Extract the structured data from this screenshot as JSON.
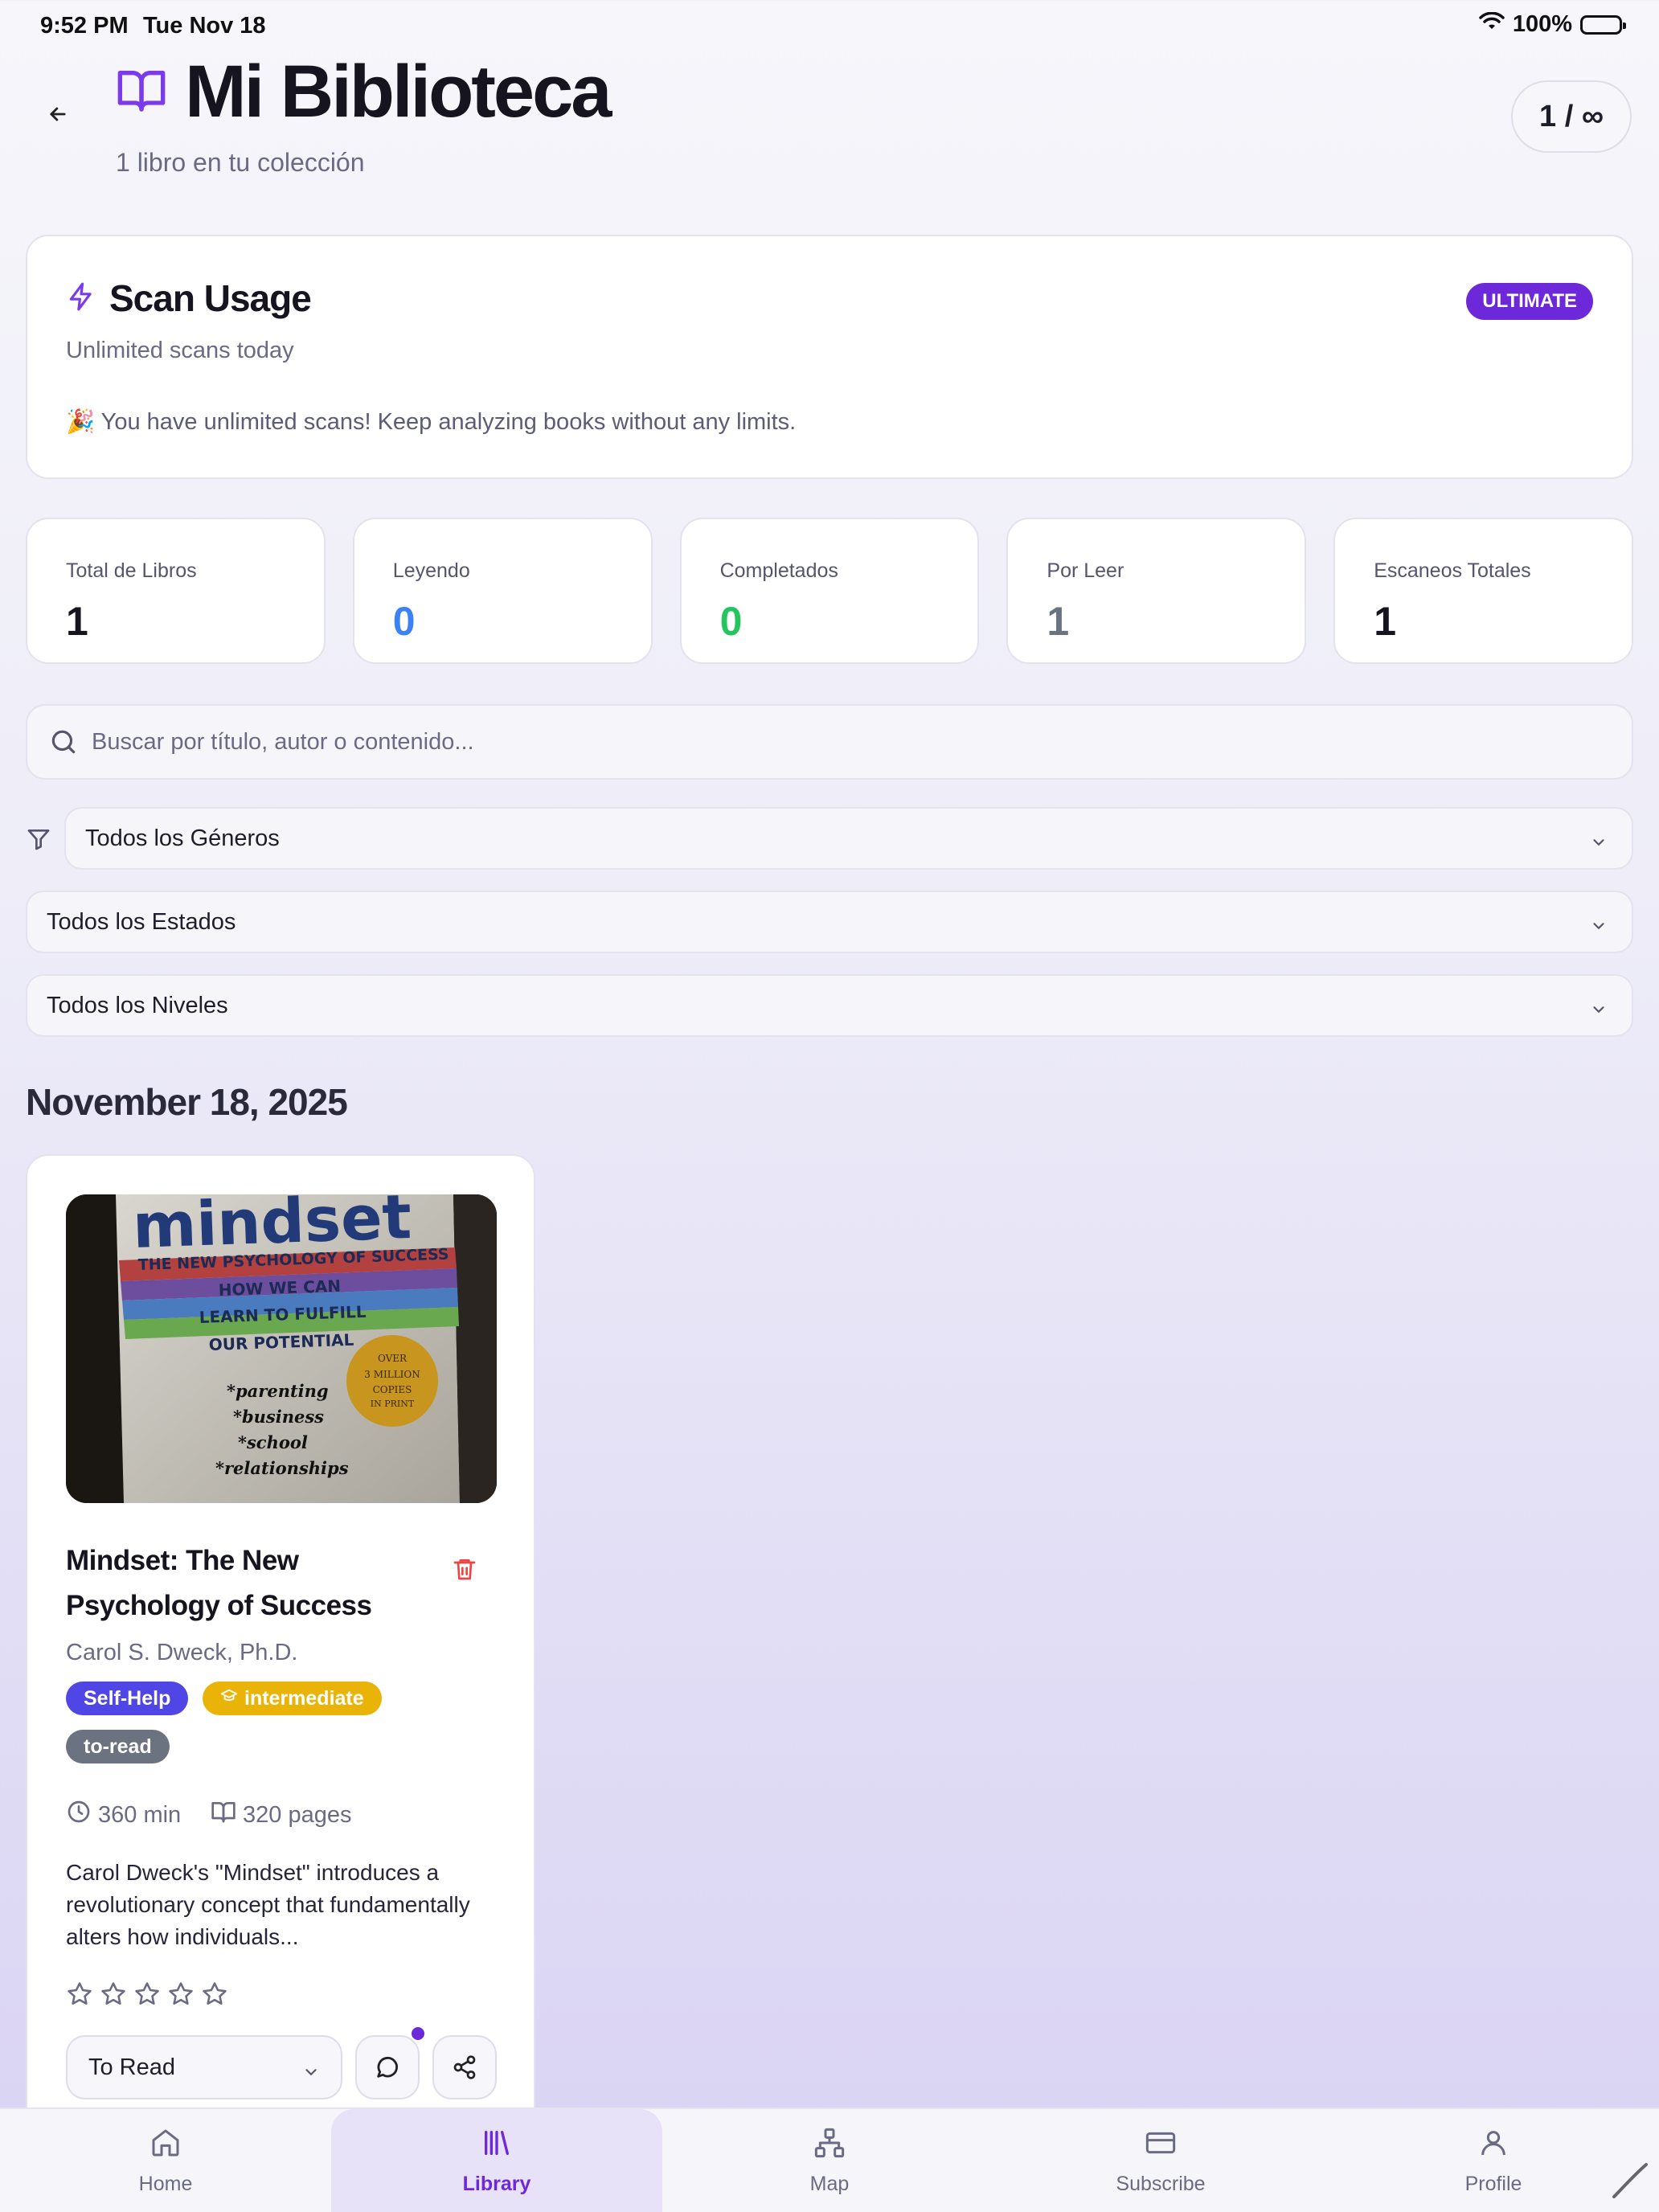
{
  "status_bar": {
    "time": "9:52 PM",
    "date": "Tue Nov 18",
    "battery": "100%"
  },
  "header": {
    "title": "Mi Biblioteca",
    "subtitle": "1 libro en tu colección",
    "counter": "1 / ∞"
  },
  "scan_usage": {
    "title": "Scan Usage",
    "subtitle": "Unlimited scans today",
    "badge": "ULTIMATE",
    "message": "🎉 You have unlimited scans! Keep analyzing books without any limits."
  },
  "stats": [
    {
      "label": "Total de Libros",
      "value": "1",
      "color": "#16151f"
    },
    {
      "label": "Leyendo",
      "value": "0",
      "color": "#3b82f6"
    },
    {
      "label": "Completados",
      "value": "0",
      "color": "#22c55e"
    },
    {
      "label": "Por Leer",
      "value": "1",
      "color": "#6b7280"
    },
    {
      "label": "Escaneos Totales",
      "value": "1",
      "color": "#16151f"
    }
  ],
  "search": {
    "placeholder": "Buscar por título, autor o contenido..."
  },
  "filters": {
    "genre": "Todos los Géneros",
    "status": "Todos los Estados",
    "level": "Todos los Niveles"
  },
  "date_group": "November 18, 2025",
  "book": {
    "cover_text": {
      "title": "mindset",
      "subtitle": "THE NEW PSYCHOLOGY OF SUCCESS",
      "line1": "HOW WE CAN",
      "line2": "LEARN TO FULFILL",
      "line3": "OUR POTENTIAL",
      "bullets": [
        "*parenting",
        "*business",
        "*school",
        "*relationships"
      ],
      "seal": [
        "OVER",
        "3 MILLION",
        "COPIES",
        "IN PRINT"
      ]
    },
    "title": "Mindset: The New Psychology of Success",
    "author": "Carol S. Dweck, Ph.D.",
    "tags": {
      "genre": "Self-Help",
      "level": "intermediate",
      "status": "to-read"
    },
    "colors": {
      "genre": "#4f46e5",
      "level": "#eab308",
      "status": "#6b7280"
    },
    "duration": "360 min",
    "pages": "320 pages",
    "description": "Carol Dweck's \"Mindset\" introduces a revolutionary concept that fundamentally alters how individuals...",
    "rating": 0,
    "status_select": "To Read"
  },
  "tabs": [
    {
      "label": "Home",
      "icon": "home-icon"
    },
    {
      "label": "Library",
      "icon": "library-icon",
      "active": true
    },
    {
      "label": "Map",
      "icon": "map-icon"
    },
    {
      "label": "Subscribe",
      "icon": "card-icon"
    },
    {
      "label": "Profile",
      "icon": "profile-icon"
    }
  ],
  "accent": "#6d28d9"
}
